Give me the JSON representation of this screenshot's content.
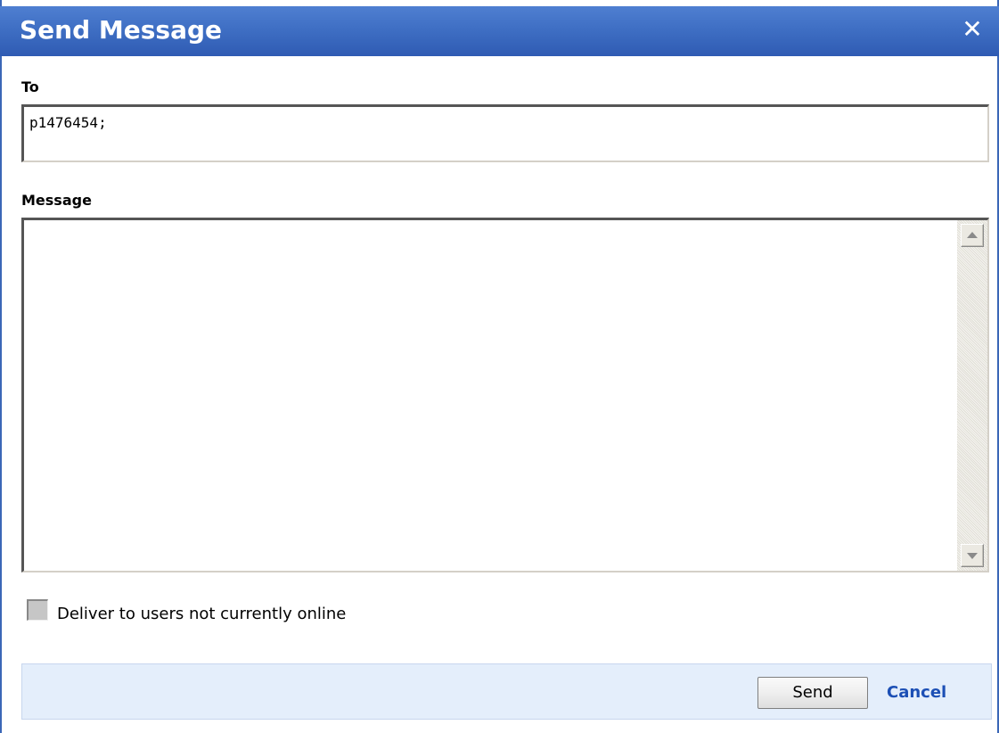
{
  "dialog": {
    "title": "Send Message",
    "close_glyph": "✕",
    "close_icon": "close-icon"
  },
  "to": {
    "label": "To",
    "value": "p1476454;"
  },
  "message": {
    "label": "Message",
    "value": ""
  },
  "options": {
    "deliver_offline_label": "Deliver to users not currently online",
    "deliver_offline_checked": false
  },
  "footer": {
    "send_label": "Send",
    "cancel_label": "Cancel"
  },
  "colors": {
    "titlebar": "#3f6fc4",
    "footer_background": "#e4eefb",
    "cancel_link": "#1c4fb5"
  }
}
